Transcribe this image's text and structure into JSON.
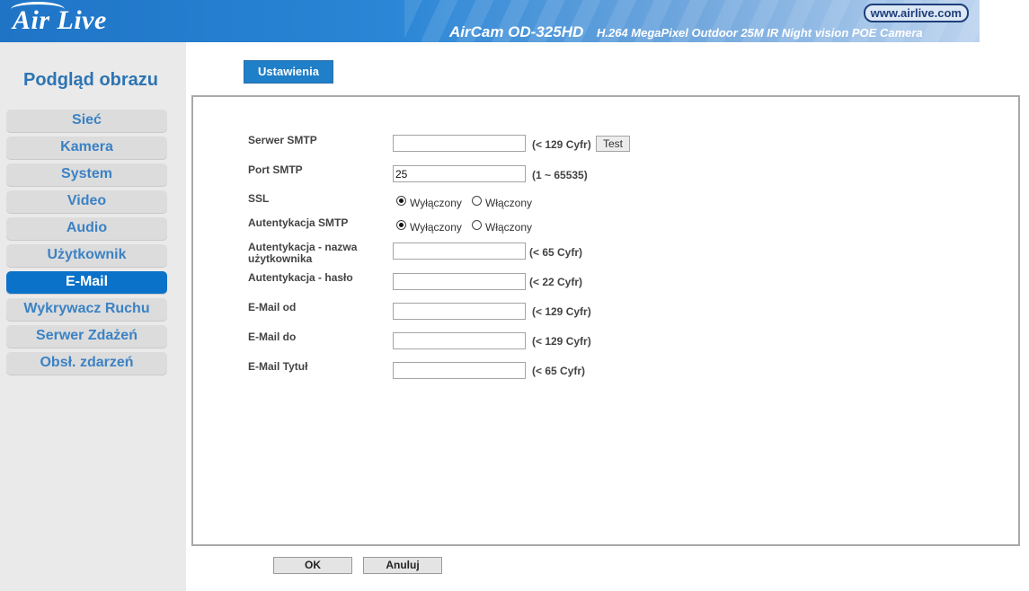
{
  "header": {
    "logo": "Air Live",
    "url": "www.airlive.com",
    "product": "AirCam OD-325HD",
    "tagline": "H.264 MegaPixel Outdoor 25M IR Night vision POE Camera"
  },
  "sidebar": {
    "title": "Podgląd obrazu",
    "items": [
      {
        "label": "Sieć"
      },
      {
        "label": "Kamera"
      },
      {
        "label": "System"
      },
      {
        "label": "Video"
      },
      {
        "label": "Audio"
      },
      {
        "label": "Użytkownik"
      },
      {
        "label": "E-Mail"
      },
      {
        "label": "Wykrywacz Ruchu"
      },
      {
        "label": "Serwer Zdażeń"
      },
      {
        "label": "Obsł. zdarzeń"
      }
    ],
    "active_index": 6
  },
  "tab": {
    "label": "Ustawienia"
  },
  "form": {
    "smtp_server": {
      "label": "Serwer SMTP",
      "value": "",
      "hint": "(< 129 Cyfr)",
      "test_label": "Test"
    },
    "smtp_port": {
      "label": "Port SMTP",
      "value": "25",
      "hint": "(1 ~ 65535)"
    },
    "ssl": {
      "label": "SSL",
      "off": "Wyłączony",
      "on": "Włączony",
      "selected": "off"
    },
    "smtp_auth": {
      "label": "Autentykacja SMTP",
      "off": "Wyłączony",
      "on": "Włączony",
      "selected": "off"
    },
    "auth_user": {
      "label": "Autentykacja - nazwa użytkownika",
      "value": "",
      "hint": "(< 65 Cyfr)"
    },
    "auth_pass": {
      "label": "Autentykacja - hasło",
      "value": "",
      "hint": "(< 22 Cyfr)"
    },
    "email_from": {
      "label": "E-Mail od",
      "value": "",
      "hint": "(< 129 Cyfr)"
    },
    "email_to": {
      "label": "E-Mail do",
      "value": "",
      "hint": "(< 129 Cyfr)"
    },
    "email_subject": {
      "label": "E-Mail Tytuł",
      "value": "",
      "hint": "(< 65 Cyfr)"
    }
  },
  "buttons": {
    "ok": "OK",
    "cancel": "Anuluj"
  }
}
